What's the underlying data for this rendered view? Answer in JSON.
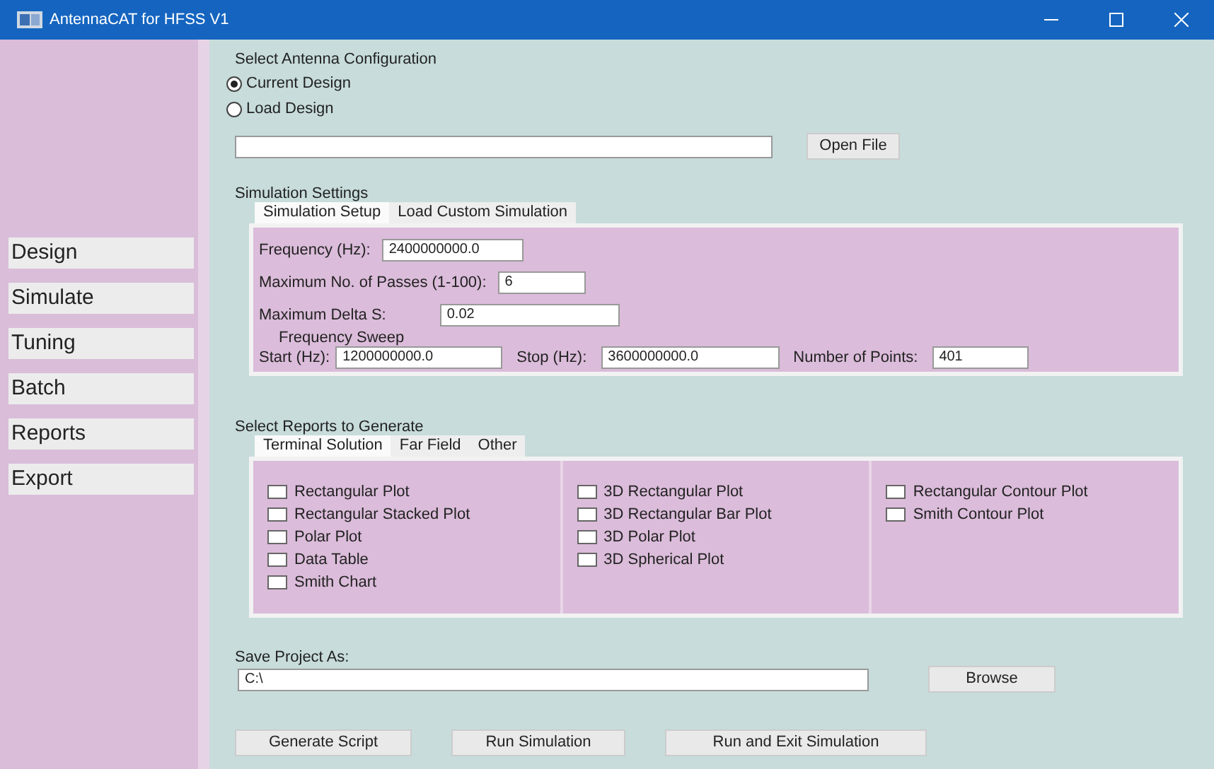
{
  "window": {
    "title": "AntennaCAT for HFSS V1"
  },
  "sidebar": {
    "items": [
      {
        "label": "Design"
      },
      {
        "label": "Simulate"
      },
      {
        "label": "Tuning"
      },
      {
        "label": "Batch"
      },
      {
        "label": "Reports"
      },
      {
        "label": "Export"
      }
    ]
  },
  "antenna_configuration": {
    "title": "Select Antenna Configuration",
    "options": [
      {
        "label": "Current Design",
        "selected": true
      },
      {
        "label": "Load Design",
        "selected": false
      }
    ],
    "open_file_button": "Open File"
  },
  "simulation_settings": {
    "title": "Simulation Settings",
    "tabs": [
      {
        "label": "Simulation Setup",
        "selected": true
      },
      {
        "label": "Load Custom Simulation",
        "selected": false
      }
    ],
    "fields": [
      {
        "label": "Frequency (Hz):",
        "value": "2400000000.0"
      },
      {
        "label": "Maximum No. of Passes (1-100):",
        "value": "6"
      },
      {
        "label": "Maximum Delta S:",
        "value": "0.02"
      }
    ],
    "frequency_sweep": {
      "title": "Frequency Sweep",
      "fields": [
        {
          "label": "Start (Hz):",
          "value": "1200000000.0"
        },
        {
          "label": "Stop (Hz):",
          "value": "3600000000.0"
        },
        {
          "label": "Number of Points:",
          "value": "401"
        }
      ]
    }
  },
  "reports": {
    "title": "Select Reports to Generate",
    "tabs": [
      {
        "label": "Terminal Solution",
        "selected": true
      },
      {
        "label": "Far Field",
        "selected": false
      },
      {
        "label": "Other",
        "selected": false
      }
    ],
    "columns": [
      {
        "items": [
          {
            "label": "Rectangular Plot",
            "checked": false
          },
          {
            "label": "Rectangular Stacked Plot",
            "checked": false
          },
          {
            "label": "Polar Plot",
            "checked": false
          },
          {
            "label": "Data Table",
            "checked": false
          },
          {
            "label": "Smith Chart",
            "checked": false
          }
        ]
      },
      {
        "items": [
          {
            "label": "3D Rectangular Plot",
            "checked": false
          },
          {
            "label": "3D Rectangular Bar Plot",
            "checked": false
          },
          {
            "label": "3D Polar Plot",
            "checked": false
          },
          {
            "label": "3D Spherical Plot",
            "checked": false
          }
        ]
      },
      {
        "items": [
          {
            "label": "Rectangular Contour Plot",
            "checked": false
          },
          {
            "label": "Smith Contour Plot",
            "checked": false
          }
        ]
      }
    ]
  },
  "save_project": {
    "label": "Save Project As:",
    "value": "C:\\",
    "browse_button": "Browse"
  },
  "actions": [
    "Generate Script",
    "Run Simulation",
    "Run and Exit Simulation"
  ]
}
